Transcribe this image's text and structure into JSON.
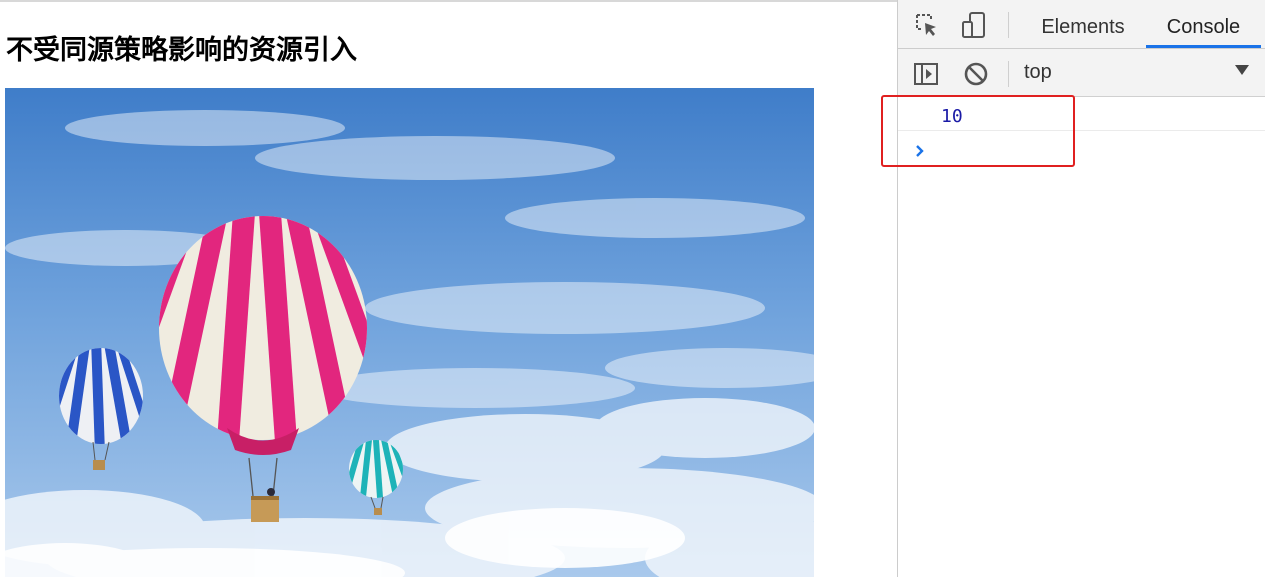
{
  "page": {
    "title": "不受同源策略影响的资源引入",
    "image": {
      "subject": "hot-air-balloons-in-blue-sky"
    }
  },
  "devtools": {
    "icons": {
      "inspect": "inspect-element-icon",
      "device": "device-toolbar-icon",
      "sidebar": "console-sidebar-icon",
      "clear": "clear-console-icon"
    },
    "tabs": [
      {
        "label": "Elements",
        "active": false
      },
      {
        "label": "Console",
        "active": true
      }
    ],
    "context": {
      "value": "top"
    },
    "console": {
      "output": [
        "10"
      ],
      "prompt_symbol": "›"
    }
  },
  "colors": {
    "accent": "#1a73e8",
    "console_number": "#1a1aa6",
    "prompt": "#1a73e8",
    "highlight": "#e02020"
  }
}
